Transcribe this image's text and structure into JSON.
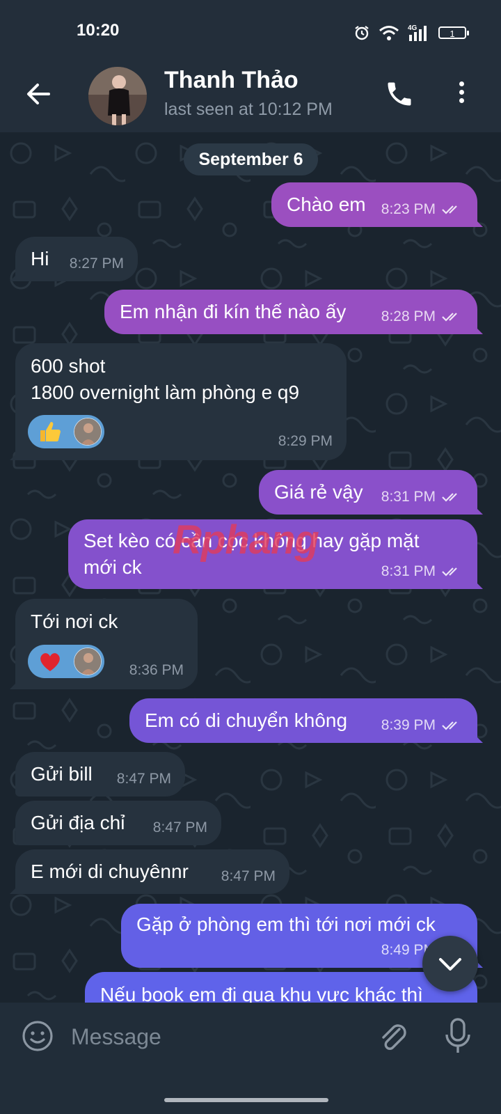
{
  "status_bar": {
    "time": "10:20",
    "battery": "1",
    "network": "4G"
  },
  "header": {
    "name": "Thanh Thảo",
    "last_seen": "last seen at 10:12 PM"
  },
  "date_separator": "September 6",
  "messages": [
    {
      "dir": "out",
      "text": "Chào em",
      "time": "8:23 PM"
    },
    {
      "dir": "in",
      "text": "Hi",
      "time": "8:27 PM"
    },
    {
      "dir": "out",
      "text": "Em nhận đi kín thế nào ấy",
      "time": "8:28 PM"
    },
    {
      "dir": "in",
      "text": "600 shot\n1800 overnight làm phòng e q9",
      "time": "8:29 PM",
      "reaction": "thumbs-up"
    },
    {
      "dir": "out",
      "text": "Giá rẻ vậy",
      "time": "8:31 PM"
    },
    {
      "dir": "out",
      "text": "Set kèo có cần cọc không hay gặp mặt\nmới ck",
      "time": "8:31 PM"
    },
    {
      "dir": "in",
      "text": "Tới nơi ck",
      "time": "8:36 PM",
      "reaction": "red-heart"
    },
    {
      "dir": "out",
      "text": "Em có di chuyển không",
      "time": "8:39 PM"
    },
    {
      "dir": "in",
      "text": "Gửi bill",
      "time": "8:47 PM"
    },
    {
      "dir": "in",
      "text": "Gửi địa chỉ",
      "time": "8:47 PM"
    },
    {
      "dir": "in",
      "text": "E mới di chuyênnr",
      "time": "8:47 PM"
    },
    {
      "dir": "out",
      "text": "Gặp ở phòng em thì tới nơi mới ck",
      "time": "8:49 PM"
    },
    {
      "dir": "out",
      "text": "Nếu book em đi qua khu vực khác thì",
      "time": ""
    }
  ],
  "watermark": {
    "part1": "Rphang",
    "part2": ""
  },
  "input": {
    "placeholder": "Message"
  },
  "colors": {
    "header_bg": "#232e3a",
    "chat_bg": "#1a242e",
    "incoming_bubble": "#26323e",
    "outgoing_gradient": [
      "#a14fbd",
      "#5f63ea"
    ]
  },
  "icons": [
    "back-arrow-icon",
    "phone-icon",
    "more-vertical-icon",
    "double-check-icon",
    "chevron-down-icon",
    "emoji-icon",
    "paperclip-icon",
    "microphone-icon"
  ]
}
